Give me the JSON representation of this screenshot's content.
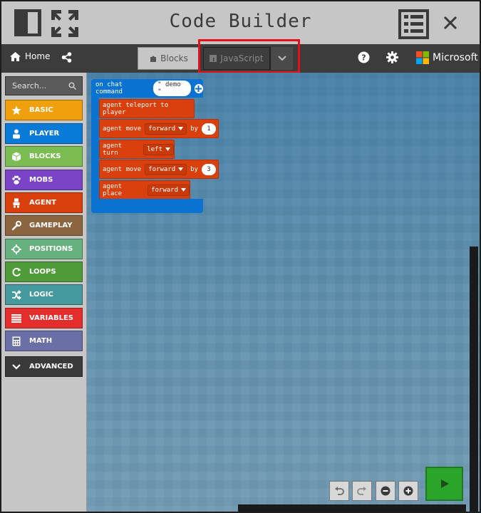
{
  "window": {
    "title": "Code Builder"
  },
  "toolbar": {
    "home_label": "Home",
    "tabs": [
      {
        "label": "Blocks"
      },
      {
        "label": "JavaScript"
      }
    ],
    "brand": "Microsoft"
  },
  "sidebar": {
    "search_placeholder": "Search...",
    "categories": [
      {
        "label": "BASIC",
        "color": "#f0a00c"
      },
      {
        "label": "PLAYER",
        "color": "#0a7ad8"
      },
      {
        "label": "BLOCKS",
        "color": "#7cbd53"
      },
      {
        "label": "MOBS",
        "color": "#7b44c7"
      },
      {
        "label": "AGENT",
        "color": "#d9400d"
      },
      {
        "label": "GAMEPLAY",
        "color": "#8a6540"
      },
      {
        "label": "POSITIONS",
        "color": "#66b17d"
      },
      {
        "label": "LOOPS",
        "color": "#4f9b3a"
      },
      {
        "label": "LOGIC",
        "color": "#46999c"
      },
      {
        "label": "VARIABLES",
        "color": "#e42d2d"
      },
      {
        "label": "MATH",
        "color": "#6a6fa6"
      },
      {
        "label": "ADVANCED",
        "color": "#3a3a3a"
      }
    ]
  },
  "workspace": {
    "event": {
      "label": "on chat command",
      "arg": "\" demo \""
    },
    "blocks": [
      {
        "text": "agent teleport to player"
      },
      {
        "text": "agent move",
        "dropdown": "forward",
        "by_label": "by",
        "value": "1"
      },
      {
        "text": "agent turn",
        "dropdown": "left"
      },
      {
        "text": "agent move",
        "dropdown": "forward",
        "by_label": "by",
        "value": "3"
      },
      {
        "text": "agent place",
        "dropdown": "forward"
      }
    ]
  }
}
